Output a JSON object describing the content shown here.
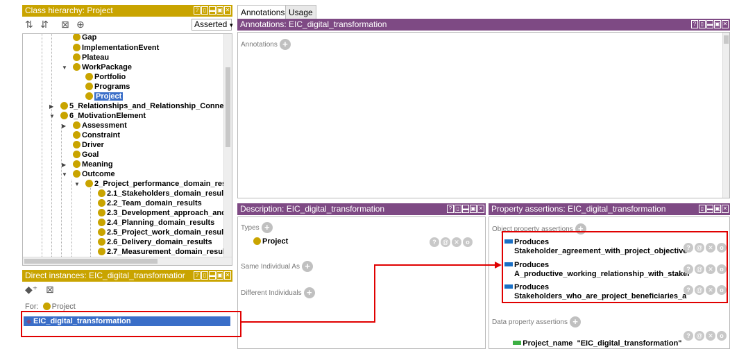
{
  "class_hierarchy": {
    "title": "Class hierarchy: Project",
    "mode": "Asserted",
    "items": [
      {
        "label": "Gap"
      },
      {
        "label": "ImplementationEvent"
      },
      {
        "label": "Plateau"
      },
      {
        "label": "WorkPackage"
      },
      {
        "label": "Portfolio"
      },
      {
        "label": "Programs"
      },
      {
        "label": "Project"
      },
      {
        "label": "5_Relationships_and_Relationship_Connecto"
      },
      {
        "label": "6_MotivationElement"
      },
      {
        "label": "Assessment"
      },
      {
        "label": "Constraint"
      },
      {
        "label": "Driver"
      },
      {
        "label": "Goal"
      },
      {
        "label": "Meaning"
      },
      {
        "label": "Outcome"
      },
      {
        "label": "2_Project_performance_domain_resu"
      },
      {
        "label": "2.1_Stakeholders_domain_results"
      },
      {
        "label": "2.2_Team_domain_results"
      },
      {
        "label": "2.3_Development_approach_and_"
      },
      {
        "label": "2.4_Planning_domain_results"
      },
      {
        "label": "2.5_Project_work_domain_results"
      },
      {
        "label": "2.6_Delivery_domain_results"
      },
      {
        "label": "2.7_Measurement_domain_results"
      }
    ]
  },
  "direct_instances": {
    "title": "Direct instances: EIC_digital_transformatior",
    "for_label": "For:",
    "for_class": "Project",
    "instance": "EIC_digital_transformation"
  },
  "tabs": [
    {
      "label": "Annotations"
    },
    {
      "label": "Usage"
    }
  ],
  "annotations": {
    "title": "Annotations: EIC_digital_transformation",
    "label": "Annotations"
  },
  "description": {
    "title": "Description: EIC_digital_transformation",
    "types_label": "Types",
    "type_value": "Project",
    "same_label": "Same Individual As",
    "different_label": "Different Individuals"
  },
  "property_assertions": {
    "title": "Property assertions: EIC_digital_transformation",
    "object_label": "Object property assertions",
    "object_items": [
      {
        "property": "Produces",
        "value": "Stakeholder_agreement_with_project_objective"
      },
      {
        "property": "Produces",
        "value": "A_productive_working_relationship_with_stakel"
      },
      {
        "property": "Produces",
        "value": "Stakeholders_who_are_project_beneficiaries_a"
      }
    ],
    "data_label": "Data property assertions",
    "data_item": "Project_name  \"EIC_digital_transformation\""
  },
  "colors": {
    "gold": "#c9a400",
    "purple": "#7e4a84",
    "highlight": "#e00000",
    "selection": "#3a6ec8"
  }
}
